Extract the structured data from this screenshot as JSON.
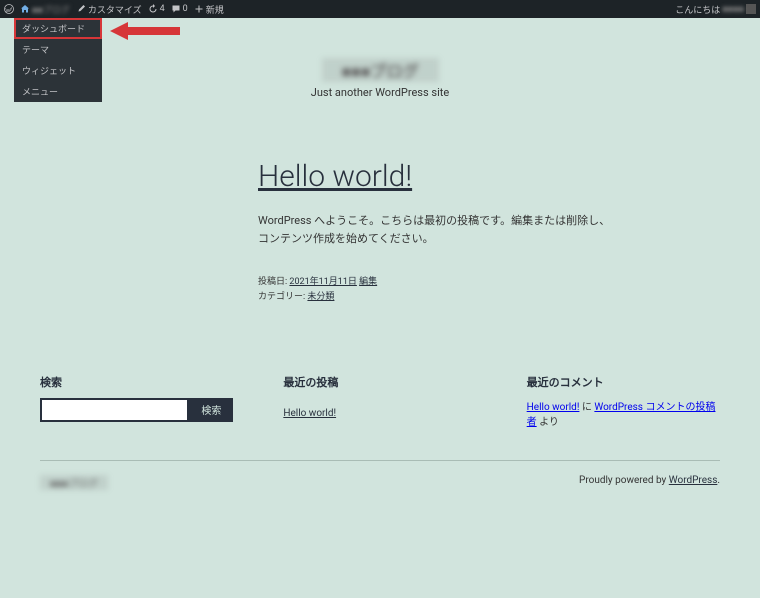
{
  "adminbar": {
    "site_name": "■■ブログ",
    "customize": "カスタマイズ",
    "updates": "4",
    "comments": "0",
    "new": "新規",
    "greeting": "こんにちは",
    "username": "■■■■"
  },
  "dropdown": {
    "items": [
      "ダッシュボード",
      "テーマ",
      "ウィジェット",
      "メニュー"
    ]
  },
  "header": {
    "site_title": "■■■ブログ",
    "tagline": "Just another WordPress site"
  },
  "post": {
    "title": "Hello world!",
    "excerpt": "WordPress へようこそ。こちらは最初の投稿です。編集または削除し、コンテンツ作成を始めてください。",
    "date_label": "投稿日:",
    "date": "2021年11月11日",
    "edit": "編集",
    "cat_label": "カテゴリー:",
    "category": "未分類"
  },
  "widgets": {
    "search": {
      "title": "検索",
      "button": "検索"
    },
    "recent_posts": {
      "title": "最近の投稿",
      "link": "Hello world!"
    },
    "recent_comments": {
      "title": "最近のコメント",
      "link1": "Hello world!",
      "mid": " に ",
      "link2": "WordPress コメントの投稿者",
      "tail": " より"
    }
  },
  "footer": {
    "site_title": "■■■ブログ",
    "powered": "Proudly powered by ",
    "wp": "WordPress"
  }
}
